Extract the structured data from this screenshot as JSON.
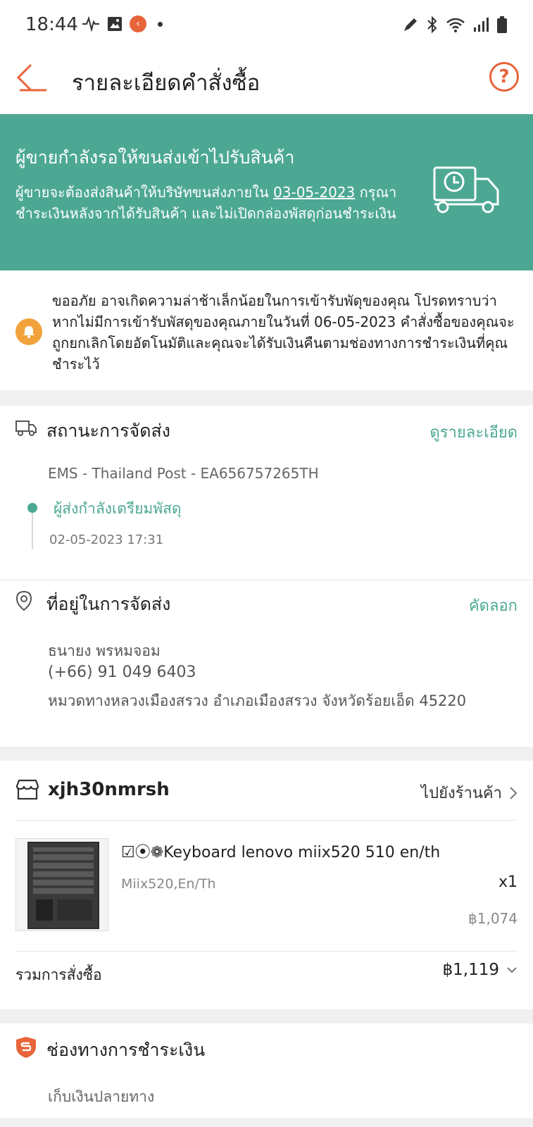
{
  "status_bar": {
    "time": "18:44",
    "left_icons": [
      "activity-icon",
      "gallery-icon",
      "app-badge-icon",
      "dot-icon"
    ],
    "right_icons": [
      "pen-icon",
      "bluetooth-icon",
      "wifi-icon",
      "signal-icon",
      "battery-icon"
    ]
  },
  "header": {
    "title": "รายละเอียดคำสั่งซื้อ",
    "help_glyph": "?"
  },
  "banner": {
    "title": "ผู้ขายกำลังรอให้ขนส่งเข้าไปรับสินค้า",
    "desc_part1": "ผู้ขายจะต้องส่งสินค้าให้บริษัทขนส่งภายใน",
    "desc_date": "03-05-2023",
    "desc_part2": "กรุณาชำระเงินหลังจากได้รับสินค้า และไม่เปิดกล่องพัสดุก่อนชำระเงิน"
  },
  "notice": {
    "text": "ขออภัย อาจเกิดความล่าช้าเล็กน้อยในการเข้ารับพัดุของคุณ โปรดทราบว่าหากไม่มีการเข้ารับพัสดุของคุณภายในวันที่ 06-05-2023 คำสั่งซื้อของคุณจะถูกยกเลิกโดยอัตโนมัติและคุณจะได้รับเงินคืนตามช่องทางการชำระเงินที่คุณชำระไว้"
  },
  "shipping": {
    "title": "สถานะการจัดส่ง",
    "link": "ดูรายละเอียด",
    "carrier": "EMS - Thailand Post - EA656757265TH",
    "status": "ผู้ส่งกำลังเตรียมพัสดุ",
    "time": "02-05-2023 17:31"
  },
  "address": {
    "title": "ที่อยู่ในการจัดส่ง",
    "link": "คัดลอก",
    "name": "ธนายง พรหมจอม",
    "phone": "(+66) 91 049 6403",
    "line": "หมวดทางหลวงเมืองสรวง อำเภอเมืองสรวง จังหวัดร้อยเอ็ด 45220"
  },
  "order": {
    "shop_name": "xjh30nmrsh",
    "shop_link": "ไปยังร้านค้า",
    "product_name": "☑⦿❁Keyboard lenovo miix520 510 en/th",
    "variant": "Miix520,En/Th",
    "qty": "x1",
    "price": "฿1,074",
    "total_label": "รวมการสั่งซื้อ",
    "total_value": "฿1,119"
  },
  "payment": {
    "title": "ช่องทางการชำระเงิน",
    "method": "เก็บเงินปลายทาง"
  },
  "colors": {
    "brand": "#e8643a",
    "accent": "#4ca893",
    "bell": "#f2a23a"
  }
}
